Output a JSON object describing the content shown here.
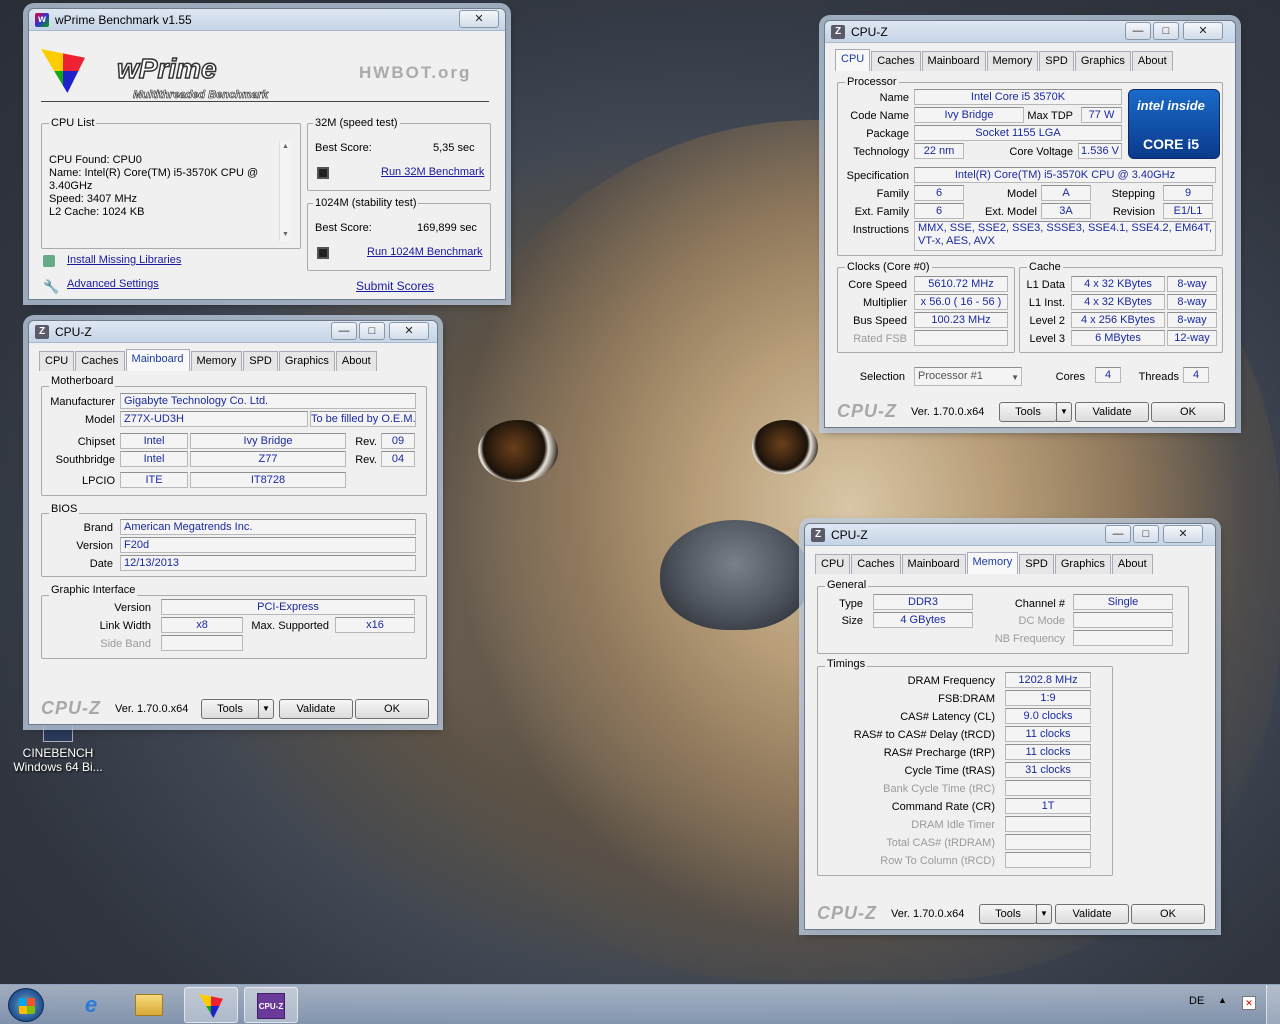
{
  "desktop": {
    "icons": [
      {
        "label": "CINEBENCH\nWindows 64 Bi..."
      }
    ]
  },
  "wprime": {
    "title": "wPrime Benchmark v1.55",
    "logo_title": "wPrime",
    "logo_subtitle": "Multithreaded Benchmark",
    "hwbot": "HWBOT.org",
    "cpu_list_label": "CPU List",
    "cpu_list_text": "CPU Found: CPU0\nName:    Intel(R) Core(TM) i5-3570K CPU @\n3.40GHz\nSpeed:   3407 MHz\nL2 Cache: 1024 KB",
    "speed_test_label": "32M (speed test)",
    "speed_best_label": "Best Score:",
    "speed_best_value": "5,35 sec",
    "speed_run": "Run 32M Benchmark",
    "stability_label": "1024M (stability test)",
    "stability_best_label": "Best Score:",
    "stability_best_value": "169,899 sec",
    "stability_run": "Run 1024M Benchmark",
    "install_libs": "Install Missing Libraries",
    "advanced": "Advanced Settings",
    "submit": "Submit Scores"
  },
  "cpuz_cpu": {
    "title": "CPU-Z",
    "tabs": [
      "CPU",
      "Caches",
      "Mainboard",
      "Memory",
      "SPD",
      "Graphics",
      "About"
    ],
    "processor_label": "Processor",
    "name_label": "Name",
    "name": "Intel Core i5 3570K",
    "codename_label": "Code Name",
    "codename": "Ivy Bridge",
    "maxtdp_label": "Max TDP",
    "maxtdp": "77 W",
    "package_label": "Package",
    "package": "Socket 1155 LGA",
    "technology_label": "Technology",
    "technology": "22 nm",
    "corevoltage_label": "Core Voltage",
    "corevoltage": "1.536 V",
    "spec_label": "Specification",
    "spec": "Intel(R) Core(TM) i5-3570K CPU @ 3.40GHz",
    "family_label": "Family",
    "family": "6",
    "model_label": "Model",
    "model": "A",
    "stepping_label": "Stepping",
    "stepping": "9",
    "extfamily_label": "Ext. Family",
    "extfamily": "6",
    "extmodel_label": "Ext. Model",
    "extmodel": "3A",
    "revision_label": "Revision",
    "revision": "E1/L1",
    "instructions_label": "Instructions",
    "instructions": "MMX, SSE, SSE2, SSE3, SSSE3, SSE4.1, SSE4.2, EM64T,\nVT-x, AES, AVX",
    "clocks_label": "Clocks (Core #0)",
    "corespeed_label": "Core Speed",
    "corespeed": "5610.72 MHz",
    "multiplier_label": "Multiplier",
    "multiplier": "x 56.0 ( 16 - 56 )",
    "busspeed_label": "Bus Speed",
    "busspeed": "100.23 MHz",
    "ratedfsb_label": "Rated FSB",
    "cache_label": "Cache",
    "l1d_label": "L1 Data",
    "l1d": "4 x 32 KBytes",
    "l1d_way": "8-way",
    "l1i_label": "L1 Inst.",
    "l1i": "4 x 32 KBytes",
    "l1i_way": "8-way",
    "l2_label": "Level 2",
    "l2": "4 x 256 KBytes",
    "l2_way": "8-way",
    "l3_label": "Level 3",
    "l3": "6 MBytes",
    "l3_way": "12-way",
    "selection_label": "Selection",
    "selection": "Processor #1",
    "cores_label": "Cores",
    "cores": "4",
    "threads_label": "Threads",
    "threads": "4",
    "intel_inside": "intel inside",
    "intel_core": "CORE i5",
    "brand": "CPU-Z",
    "version": "Ver. 1.70.0.x64",
    "tools": "Tools",
    "validate": "Validate",
    "ok": "OK"
  },
  "cpuz_mb": {
    "title": "CPU-Z",
    "tabs": [
      "CPU",
      "Caches",
      "Mainboard",
      "Memory",
      "SPD",
      "Graphics",
      "About"
    ],
    "motherboard_label": "Motherboard",
    "manufacturer_label": "Manufacturer",
    "manufacturer": "Gigabyte Technology Co. Ltd.",
    "model_label": "Model",
    "model": "Z77X-UD3H",
    "model_extra": "To be filled by O.E.M.",
    "chipset_label": "Chipset",
    "chipset_vendor": "Intel",
    "chipset_name": "Ivy Bridge",
    "chipset_rev_label": "Rev.",
    "chipset_rev": "09",
    "southbridge_label": "Southbridge",
    "sb_vendor": "Intel",
    "sb_name": "Z77",
    "sb_rev_label": "Rev.",
    "sb_rev": "04",
    "lpcio_label": "LPCIO",
    "lpcio_vendor": "ITE",
    "lpcio_name": "IT8728",
    "bios_label": "BIOS",
    "brand_label": "Brand",
    "bios_brand": "American Megatrends Inc.",
    "version_label": "Version",
    "bios_version": "F20d",
    "date_label": "Date",
    "bios_date": "12/13/2013",
    "gi_label": "Graphic Interface",
    "gi_version_label": "Version",
    "gi_version": "PCI-Express",
    "linkwidth_label": "Link Width",
    "linkwidth": "x8",
    "maxsupported_label": "Max. Supported",
    "maxsupported": "x16",
    "sideband_label": "Side Band",
    "brand": "CPU-Z",
    "version": "Ver. 1.70.0.x64",
    "tools": "Tools",
    "validate": "Validate",
    "ok": "OK"
  },
  "cpuz_mem": {
    "title": "CPU-Z",
    "tabs": [
      "CPU",
      "Caches",
      "Mainboard",
      "Memory",
      "SPD",
      "Graphics",
      "About"
    ],
    "general_label": "General",
    "type_label": "Type",
    "type": "DDR3",
    "channel_label": "Channel #",
    "channel": "Single",
    "size_label": "Size",
    "size": "4 GBytes",
    "dcmode_label": "DC Mode",
    "nbfreq_label": "NB Frequency",
    "timings_label": "Timings",
    "dram_freq_label": "DRAM Frequency",
    "dram_freq": "1202.8 MHz",
    "fsbdram_label": "FSB:DRAM",
    "fsbdram": "1:9",
    "cas_label": "CAS# Latency (CL)",
    "cas": "9.0 clocks",
    "trcd_label": "RAS# to CAS# Delay (tRCD)",
    "trcd": "11 clocks",
    "trp_label": "RAS# Precharge (tRP)",
    "trp": "11 clocks",
    "tras_label": "Cycle Time (tRAS)",
    "tras": "31 clocks",
    "trc_label": "Bank Cycle Time (tRC)",
    "cr_label": "Command Rate (CR)",
    "cr": "1T",
    "idle_label": "DRAM Idle Timer",
    "trdram_label": "Total CAS# (tRDRAM)",
    "trcd2_label": "Row To Column (tRCD)",
    "brand": "CPU-Z",
    "version": "Ver. 1.70.0.x64",
    "tools": "Tools",
    "validate": "Validate",
    "ok": "OK"
  },
  "taskbar": {
    "language": "DE",
    "cpuz_label": "CPU-Z"
  },
  "colors": {
    "value_text": "#1a2aa0",
    "active_tab": "#1a3ca0",
    "link": "#1a1aa0"
  }
}
